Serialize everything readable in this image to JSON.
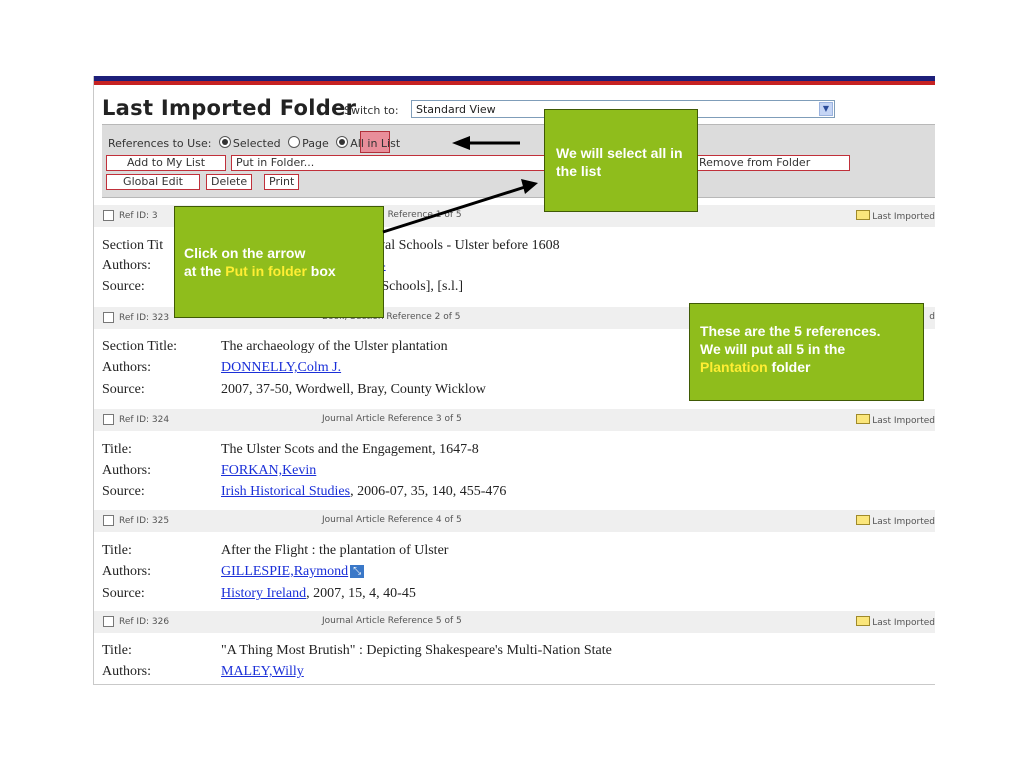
{
  "page": {
    "title": "Last Imported Folder",
    "switch_to_label": "Switch to:",
    "view_select_value": "Standard View"
  },
  "toolbar": {
    "references_label": "References to Use:",
    "radio_selected": "Selected",
    "radio_page": "Page",
    "radio_all": "All in List",
    "add_to_my_list": "Add to My List",
    "put_in_folder": "Put in Folder...",
    "remove_from_folder": "Remove from Folder",
    "global_edit": "Global Edit",
    "delete": "Delete",
    "print": "Print"
  },
  "references": [
    {
      "ref_id": "Ref ID: 3",
      "type": "ion Reference 1 of 5",
      "folder": "Last Imported",
      "fields": [
        {
          "label": "Section Tit",
          "value": "oyal Schools - Ulster before 1608",
          "link": false
        },
        {
          "label": "Authors:",
          "value": "1-",
          "link": true
        },
        {
          "label": "Source:",
          "value": "l Schools], [s.l.]",
          "link": false
        }
      ]
    },
    {
      "ref_id": "Ref ID: 323",
      "type": "Book, Section Reference 2 of 5",
      "folder": "d",
      "fields": [
        {
          "label": "Section Title:",
          "value": "The archaeology of the Ulster plantation",
          "link": false
        },
        {
          "label": "Authors:",
          "value": "DONNELLY,Colm J.",
          "link": true
        },
        {
          "label": "Source:",
          "value": "2007, 37-50, Wordwell, Bray, County Wicklow",
          "link": false
        }
      ]
    },
    {
      "ref_id": "Ref ID: 324",
      "type": "Journal Article Reference 3 of 5",
      "folder": "Last Imported",
      "fields": [
        {
          "label": "Title:",
          "value": "The Ulster Scots and the Engagement, 1647-8",
          "link": false
        },
        {
          "label": "Authors:",
          "value": "FORKAN,Kevin",
          "link": true
        },
        {
          "label": "Source:",
          "link_part": "Irish Historical Studies",
          "value": ", 2006-07, 35, 140, 455-476",
          "link": false
        }
      ]
    },
    {
      "ref_id": "Ref ID: 325",
      "type": "Journal Article Reference 4 of 5",
      "folder": "Last Imported",
      "fields": [
        {
          "label": "Title:",
          "value": "After the Flight : the plantation of Ulster",
          "link": false
        },
        {
          "label": "Authors:",
          "value": "GILLESPIE,Raymond",
          "link": true
        },
        {
          "label": "Source:",
          "link_part": "History Ireland",
          "value": ", 2007, 15, 4, 40-45",
          "link": false
        }
      ]
    },
    {
      "ref_id": "Ref ID: 326",
      "type": "Journal Article Reference 5 of 5",
      "folder": "Last Imported",
      "fields": [
        {
          "label": "Title:",
          "value": "\"A Thing Most Brutish\" : Depicting Shakespeare's Multi-Nation State",
          "link": false
        },
        {
          "label": "Authors:",
          "value": "MALEY,Willy",
          "link": true
        }
      ]
    }
  ],
  "notes": {
    "select_all": "We will select all in the list",
    "click_arrow_line1": "Click on the arrow",
    "click_arrow_line2_pre": "at the ",
    "click_arrow_highlight": "Put in folder",
    "click_arrow_line2_post": " box",
    "five_refs_line1": "These are the 5 references.",
    "five_refs_line2": "We will put all 5 in the",
    "five_refs_highlight": "Plantation",
    "five_refs_post": " folder"
  },
  "colors": {
    "note_green": "#8fbd1c",
    "highlight_yellow": "#ffee33",
    "link_blue": "#1a2fd8",
    "button_border_red": "#c0303a"
  }
}
